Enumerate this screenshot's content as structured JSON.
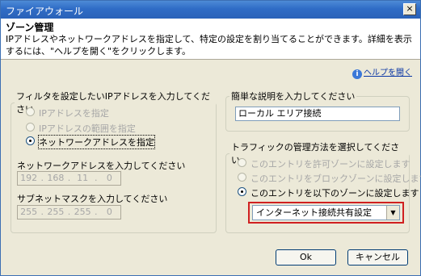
{
  "window": {
    "title": "ファイアウォール",
    "close_glyph": "×"
  },
  "header": {
    "title": "ゾーン管理",
    "description": "IPアドレスやネットワークアドレスを指定して、特定の設定を割り当てることができます。詳細を表示するには、\"ヘルプを開く\"をクリックします。"
  },
  "help_link": {
    "label": "ヘルプを開く"
  },
  "filter": {
    "legend": "フィルタを設定したいIPアドレスを入力してください",
    "options": [
      {
        "label": "IPアドレスを指定",
        "checked": false,
        "enabled": false
      },
      {
        "label": "IPアドレスの範囲を指定",
        "checked": false,
        "enabled": false
      },
      {
        "label": "ネットワークアドレスを指定",
        "checked": true,
        "enabled": true
      }
    ],
    "network_label": "ネットワークアドレスを入力してください",
    "network_octets": [
      "192",
      "168",
      "11",
      "0"
    ],
    "subnet_label": "サブネットマスクを入力してください",
    "subnet_octets": [
      "255",
      "255",
      "255",
      "0"
    ]
  },
  "description_box": {
    "legend": "簡単な説明を入力してください",
    "value": "ローカル エリア接続"
  },
  "traffic": {
    "legend": "トラフィックの管理方法を選択してください",
    "options": [
      {
        "label": "このエントリを許可ゾーンに設定します",
        "checked": false,
        "enabled": false
      },
      {
        "label": "このエントリをブロックゾーンに設定します",
        "checked": false,
        "enabled": false
      },
      {
        "label": "このエントリを以下のゾーンに設定します",
        "checked": true,
        "enabled": true
      }
    ],
    "zone_selected": "インターネット接続共有設定"
  },
  "buttons": {
    "ok": "Ok",
    "cancel": "キャンセル"
  }
}
